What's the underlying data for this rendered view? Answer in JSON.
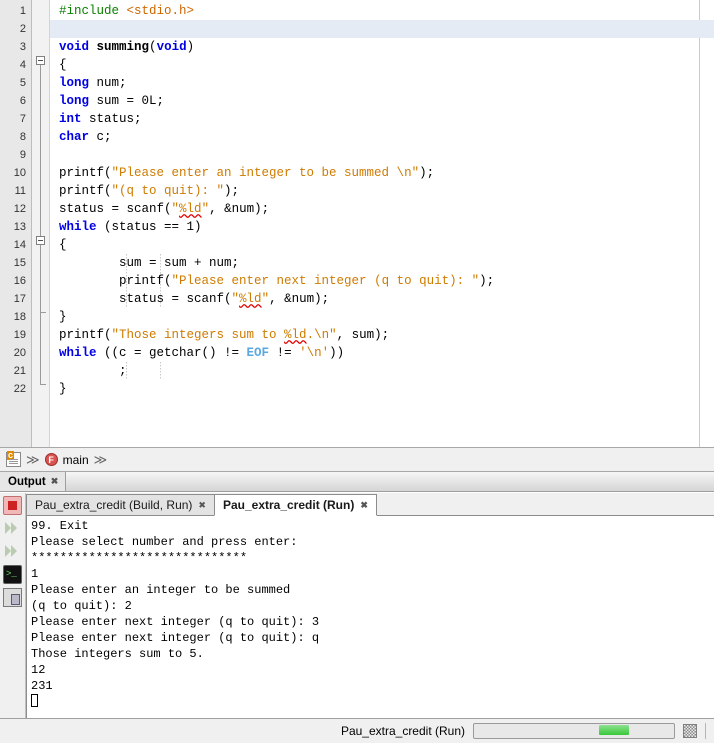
{
  "editor": {
    "margin_column_guide": true,
    "current_line": 2,
    "lines": [
      {
        "n": 1,
        "tokens": [
          {
            "t": "pre",
            "s": "#include"
          },
          {
            "t": "plain",
            "s": " "
          },
          {
            "t": "inc",
            "s": "<stdio.h>"
          }
        ]
      },
      {
        "n": 2,
        "tokens": []
      },
      {
        "n": 3,
        "tokens": [
          {
            "t": "kw",
            "s": "void"
          },
          {
            "t": "plain",
            "s": " "
          },
          {
            "t": "fn",
            "s": "summing"
          },
          {
            "t": "plain",
            "s": "("
          },
          {
            "t": "kw",
            "s": "void"
          },
          {
            "t": "plain",
            "s": ")"
          }
        ]
      },
      {
        "n": 4,
        "tokens": [
          {
            "t": "plain",
            "s": "{"
          }
        ]
      },
      {
        "n": 5,
        "tokens": [
          {
            "t": "kw",
            "s": "long"
          },
          {
            "t": "plain",
            "s": " num;"
          }
        ]
      },
      {
        "n": 6,
        "tokens": [
          {
            "t": "kw",
            "s": "long"
          },
          {
            "t": "plain",
            "s": " sum = 0L;"
          }
        ]
      },
      {
        "n": 7,
        "tokens": [
          {
            "t": "kw",
            "s": "int"
          },
          {
            "t": "plain",
            "s": " status;"
          }
        ]
      },
      {
        "n": 8,
        "tokens": [
          {
            "t": "kw",
            "s": "char"
          },
          {
            "t": "plain",
            "s": " c;"
          }
        ]
      },
      {
        "n": 9,
        "tokens": []
      },
      {
        "n": 10,
        "tokens": [
          {
            "t": "plain",
            "s": "printf("
          },
          {
            "t": "str",
            "s": "\"Please enter an integer to be summed \\n\""
          },
          {
            "t": "plain",
            "s": ");"
          }
        ]
      },
      {
        "n": 11,
        "tokens": [
          {
            "t": "plain",
            "s": "printf("
          },
          {
            "t": "str",
            "s": "\"(q to quit): \""
          },
          {
            "t": "plain",
            "s": ");"
          }
        ]
      },
      {
        "n": 12,
        "tokens": [
          {
            "t": "plain",
            "s": "status = scanf("
          },
          {
            "t": "str",
            "s": "\""
          },
          {
            "t": "err",
            "s": "%ld"
          },
          {
            "t": "str",
            "s": "\""
          },
          {
            "t": "plain",
            "s": ", &num);"
          }
        ]
      },
      {
        "n": 13,
        "tokens": [
          {
            "t": "kw",
            "s": "while"
          },
          {
            "t": "plain",
            "s": " (status == 1)"
          }
        ]
      },
      {
        "n": 14,
        "tokens": [
          {
            "t": "plain",
            "s": "{"
          }
        ]
      },
      {
        "n": 15,
        "tokens": [
          {
            "t": "plain",
            "s": "        sum = sum + num;"
          }
        ]
      },
      {
        "n": 16,
        "tokens": [
          {
            "t": "plain",
            "s": "        printf("
          },
          {
            "t": "str",
            "s": "\"Please enter next integer (q to quit): \""
          },
          {
            "t": "plain",
            "s": ");"
          }
        ]
      },
      {
        "n": 17,
        "tokens": [
          {
            "t": "plain",
            "s": "        status = scanf("
          },
          {
            "t": "str",
            "s": "\""
          },
          {
            "t": "err",
            "s": "%ld"
          },
          {
            "t": "str",
            "s": "\""
          },
          {
            "t": "plain",
            "s": ", &num);"
          }
        ]
      },
      {
        "n": 18,
        "tokens": [
          {
            "t": "plain",
            "s": "}"
          }
        ]
      },
      {
        "n": 19,
        "tokens": [
          {
            "t": "plain",
            "s": "printf("
          },
          {
            "t": "str",
            "s": "\"Those integers sum to "
          },
          {
            "t": "err",
            "s": "%ld"
          },
          {
            "t": "str",
            "s": ".\\n\""
          },
          {
            "t": "plain",
            "s": ", sum);"
          }
        ]
      },
      {
        "n": 20,
        "tokens": [
          {
            "t": "kw",
            "s": "while"
          },
          {
            "t": "plain",
            "s": " ((c = getchar() != "
          },
          {
            "t": "macro",
            "s": "EOF"
          },
          {
            "t": "plain",
            "s": " != "
          },
          {
            "t": "str",
            "s": "'\\n'"
          },
          {
            "t": "plain",
            "s": "))"
          }
        ]
      },
      {
        "n": 21,
        "tokens": [
          {
            "t": "plain",
            "s": "        ;"
          }
        ]
      },
      {
        "n": 22,
        "tokens": [
          {
            "t": "plain",
            "s": "}"
          }
        ]
      }
    ]
  },
  "breadcrumb": {
    "file_icon": "c-file-icon",
    "function_icon": "function-icon",
    "function_label": "main",
    "chevron": "≫"
  },
  "output_window": {
    "title": "Output",
    "close_glyph": "✖",
    "toolbar": [
      {
        "name": "stop-button",
        "icon": "stop-icon",
        "enabled": true
      },
      {
        "name": "rerun-button-1",
        "icon": "rerun-icon",
        "enabled": false
      },
      {
        "name": "rerun-button-2",
        "icon": "rerun-icon",
        "enabled": false
      },
      {
        "name": "terminal-button",
        "icon": "terminal-icon",
        "enabled": true
      },
      {
        "name": "copy-button",
        "icon": "copy-icon",
        "enabled": true
      }
    ],
    "tabs": [
      {
        "label": "Pau_extra_credit (Build, Run)",
        "active": false
      },
      {
        "label": "Pau_extra_credit (Run)",
        "active": true
      }
    ],
    "console_lines": [
      "99. Exit",
      "Please select number and press enter:",
      "******************************",
      "1",
      "Please enter an integer to be summed",
      "(q to quit): 2",
      "Please enter next integer (q to quit): 3",
      "Please enter next integer (q to quit): q",
      "Those integers sum to 5.",
      "12",
      "231"
    ],
    "caret": true
  },
  "statusbar": {
    "task_label": "Pau_extra_credit (Run)",
    "progress_indeterminate": true,
    "progress_color": "#38c838",
    "stop_button_icon": "progress-stop-icon"
  }
}
